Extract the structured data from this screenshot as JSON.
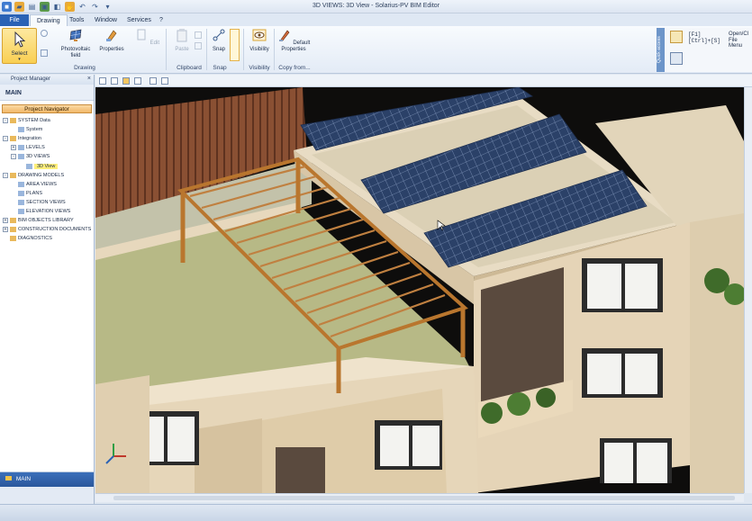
{
  "window": {
    "title": "3D VIEWS: 3D View - Solarius-PV BIM Editor"
  },
  "menu": {
    "tabs": [
      {
        "label": "File"
      },
      {
        "label": "Drawing"
      },
      {
        "label": "Tools"
      },
      {
        "label": "Window"
      },
      {
        "label": "Services"
      },
      {
        "label": "?"
      }
    ]
  },
  "ribbon": {
    "select_label": "Select",
    "photovoltaic_label": "Photovoltaic field",
    "properties_label": "Properties",
    "edit_label": "Edit",
    "paste_label": "Paste",
    "snap_label": "Snap",
    "visibility_label": "Visibility",
    "default_props_label": "Default Properties",
    "groups": {
      "drawing": "Drawing",
      "clipboard": "Clipboard",
      "snap": "Snap",
      "visibility": "Visibility",
      "copy_from": "Copy from..."
    },
    "quick_access": "Quick access",
    "shortcut1": "[F1]",
    "shortcut2": "[Ctrl]+[S]",
    "help1": "Open/Cl",
    "help2": "File Menu"
  },
  "left_pane": {
    "header": "Project Manager",
    "main_label": "MAIN",
    "navigator_title": "Project Navigator",
    "tree": [
      {
        "label": "SYSTEM Data",
        "level": 0,
        "exp": "-"
      },
      {
        "label": "System",
        "level": 1,
        "exp": ""
      },
      {
        "label": "Integration",
        "level": 0,
        "exp": "-"
      },
      {
        "label": "LEVELS",
        "level": 1,
        "exp": "+"
      },
      {
        "label": "3D VIEWS",
        "level": 1,
        "exp": "-"
      },
      {
        "label": "3D View",
        "level": 2,
        "exp": "",
        "selected": true
      },
      {
        "label": "DRAWING MODELS",
        "level": 0,
        "exp": "-"
      },
      {
        "label": "AREA VIEWS",
        "level": 1,
        "exp": ""
      },
      {
        "label": "PLANS",
        "level": 1,
        "exp": ""
      },
      {
        "label": "SECTION VIEWS",
        "level": 1,
        "exp": ""
      },
      {
        "label": "ELEVATION VIEWS",
        "level": 1,
        "exp": ""
      },
      {
        "label": "BIM OBJECTS LIBRARY",
        "level": 0,
        "exp": "+"
      },
      {
        "label": "CONSTRUCTION DOCUMENTS",
        "level": 0,
        "exp": "+"
      },
      {
        "label": "DIAGNOSTICS",
        "level": 0,
        "exp": ""
      }
    ],
    "bottom_label": "MAIN"
  },
  "colors": {
    "accent": "#2a62b5",
    "select_btn": "#f9cf52",
    "navigator": "#f1b868",
    "selected_item": "#ffef7a",
    "wood": "#b9762e",
    "facade": "#e5d4b7",
    "roof": "#b8b884"
  }
}
